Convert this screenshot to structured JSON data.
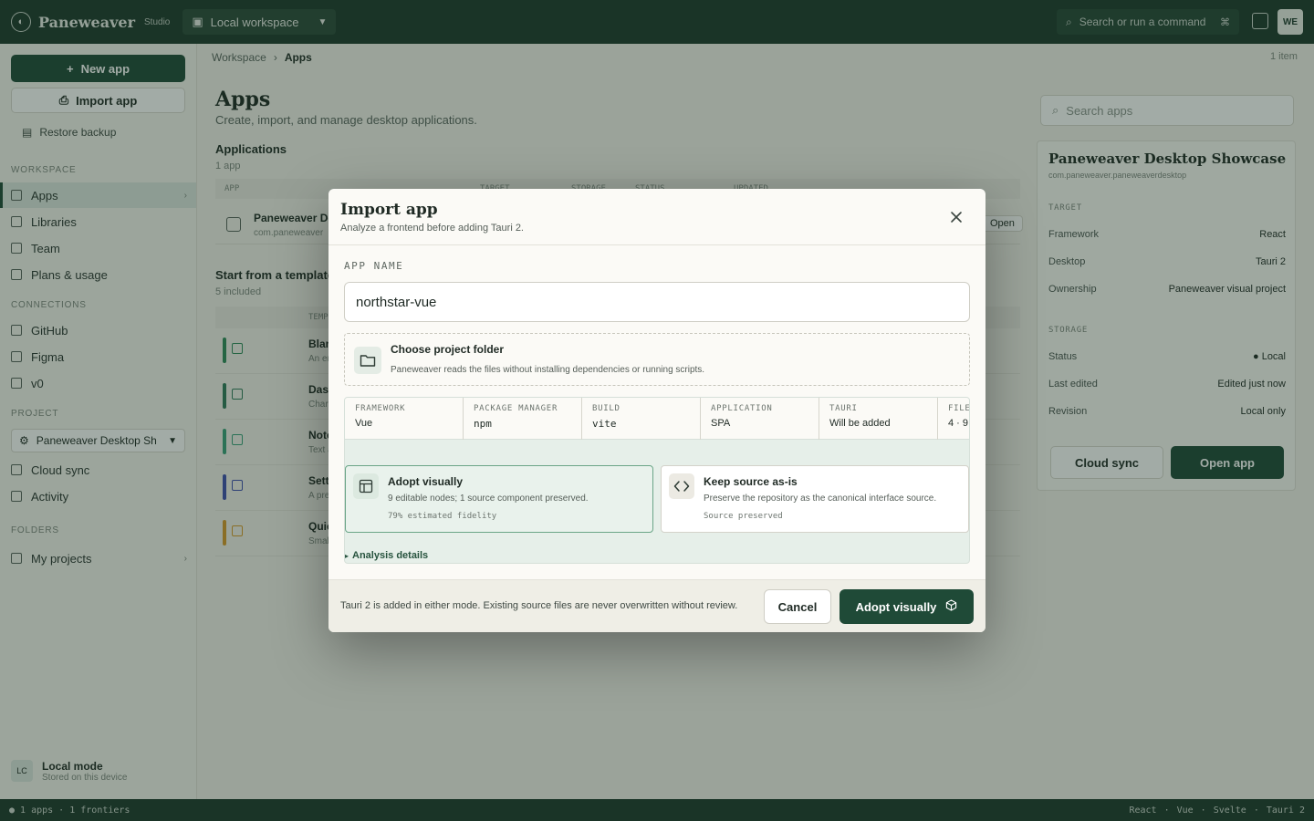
{
  "topbar": {
    "brand": "Paneweaver",
    "brand_badge": "Studio",
    "workspace": "Local workspace",
    "command_placeholder": "Search or run a command",
    "command_kbd": "⌘",
    "avatar": "WE"
  },
  "sidebar": {
    "new_app": "New app",
    "import_app": "Import app",
    "restore": "Restore backup",
    "workspace_label": "WORKSPACE",
    "workspace_items": [
      "Apps",
      "Libraries",
      "Team",
      "Plans & usage"
    ],
    "connections_label": "CONNECTIONS",
    "connection_items": [
      "GitHub",
      "Figma",
      "v0"
    ],
    "project_label": "PROJECT",
    "project_select": "Paneweaver Desktop Sh",
    "project_items": [
      "Cloud sync",
      "Activity"
    ],
    "folders_label": "FOLDERS",
    "folder_items": [
      "My projects"
    ],
    "local_mode_title": "Local mode",
    "local_mode_sub": "Stored on this device",
    "local_mode_avatar": "LC"
  },
  "main": {
    "breadcrumb": [
      "Workspace",
      "Apps"
    ],
    "breadcrumb_right": "1 item",
    "title": "Apps",
    "subtitle": "Create, import, and manage desktop applications.",
    "search_placeholder": "Search apps",
    "applications_label": "Applications",
    "applications_count": "1 app",
    "table_headers": [
      "APP",
      "TARGET",
      "STORAGE",
      "STATUS",
      "UPDATED"
    ],
    "app_row": {
      "name": "Paneweaver De",
      "sub": "com.paneweaver",
      "action": "Open"
    },
    "templates_label": "Start from a template",
    "templates_count": "5 included",
    "templates_header": "TEMPLATE",
    "templates": [
      {
        "name": "Blank",
        "sub": "An empty desktop app",
        "color": "#2f8a5a"
      },
      {
        "name": "Dashboard",
        "sub": "Charts and panels",
        "color": "#2f7a5a"
      },
      {
        "name": "Notes",
        "sub": "Text and folders",
        "color": "#3aa07a"
      },
      {
        "name": "Settings",
        "sub": "A preferences shell",
        "color": "#3f4fb0"
      },
      {
        "name": "Quick tools",
        "sub": "Small utilities",
        "color": "#d89a2a"
      }
    ]
  },
  "detail": {
    "title": "Paneweaver Desktop Showcase",
    "sub": "com.paneweaver.paneweaverdesktop",
    "target_label": "TARGET",
    "target": [
      [
        "Framework",
        "React"
      ],
      [
        "Desktop",
        "Tauri 2"
      ],
      [
        "Ownership",
        "Paneweaver visual project"
      ]
    ],
    "storage_label": "STORAGE",
    "storage": [
      [
        "Status",
        "● Local"
      ],
      [
        "Last edited",
        "Edited just now"
      ],
      [
        "Revision",
        "Local only"
      ]
    ],
    "cloud_btn": "Cloud sync",
    "open_btn": "Open app"
  },
  "statusbar": {
    "left": "● 1 apps · 1 frontiers",
    "right": [
      "React",
      "Vue",
      "Svelte",
      "Tauri 2"
    ]
  },
  "modal": {
    "title": "Import app",
    "subtitle": "Analyze a frontend before adding Tauri 2.",
    "app_name_label": "APP NAME",
    "app_name_value": "northstar-vue",
    "folder_title": "Choose project folder",
    "folder_sub": "Paneweaver reads the files without installing dependencies or running scripts.",
    "facts": [
      {
        "k": "FRAMEWORK",
        "v": "Vue"
      },
      {
        "k": "PACKAGE MANAGER",
        "v": "npm"
      },
      {
        "k": "BUILD",
        "v": "vite"
      },
      {
        "k": "APPLICATION",
        "v": "SPA"
      },
      {
        "k": "TAURI",
        "v": "Will be added"
      },
      {
        "k": "FILES",
        "v": "4 · 9"
      }
    ],
    "modes": [
      {
        "title": "Adopt visually",
        "desc": "9 editable nodes; 1 source component preserved.",
        "meta": "79% estimated fidelity"
      },
      {
        "title": "Keep source as-is",
        "desc": "Preserve the repository as the canonical interface source.",
        "meta": "Source preserved"
      }
    ],
    "details_toggle": "Analysis details",
    "footer_note": "Tauri 2 is added in either mode. Existing source files are never overwritten without review.",
    "cancel": "Cancel",
    "confirm": "Adopt visually"
  },
  "colors": {
    "accent": "#1f4a37",
    "topbar": "#1d3a2c",
    "selected_card": "#e9f2ec"
  }
}
